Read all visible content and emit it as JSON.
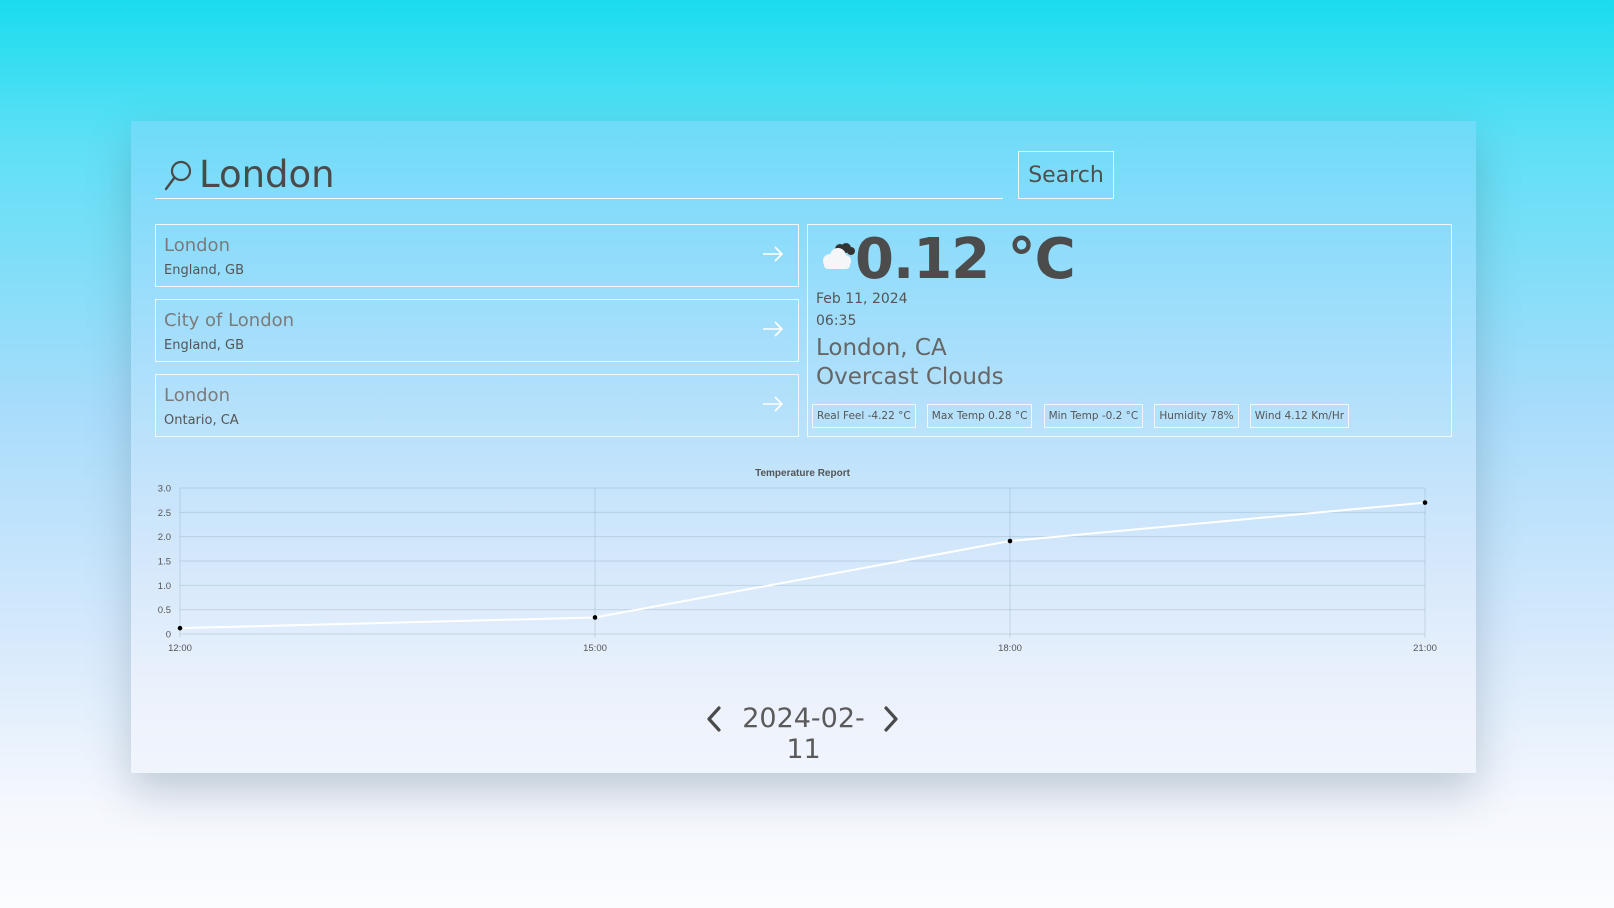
{
  "search": {
    "value": "London",
    "button_label": "Search"
  },
  "results": [
    {
      "name": "London",
      "region": "England, GB"
    },
    {
      "name": "City of London",
      "region": "England, GB"
    },
    {
      "name": "London",
      "region": "Ontario, CA"
    }
  ],
  "weather": {
    "icon": "cloud-icon",
    "temperature": "0.12 °C",
    "date": "Feb 11, 2024",
    "time": "06:35",
    "location": "London, CA",
    "condition": "Overcast Clouds",
    "stats": [
      "Real Feel -4.22 °C",
      "Max Temp 0.28 °C",
      "Min Temp -0.2 °C",
      "Humidity 78%",
      "Wind 4.12 Km/Hr"
    ]
  },
  "chart_data": {
    "type": "line",
    "title": "Temperature Report",
    "categories": [
      "12:00",
      "15:00",
      "18:00",
      "21:00"
    ],
    "values": [
      0.12,
      0.34,
      1.91,
      2.7
    ],
    "ylim": [
      0,
      3.0
    ],
    "yticks": [
      "0",
      "0.5",
      "1.0",
      "1.5",
      "2.0",
      "2.5",
      "3.0"
    ],
    "grid": true,
    "line_color": "#ffffff",
    "point_color": "#000000"
  },
  "pager": {
    "date": "2024-02-11"
  }
}
